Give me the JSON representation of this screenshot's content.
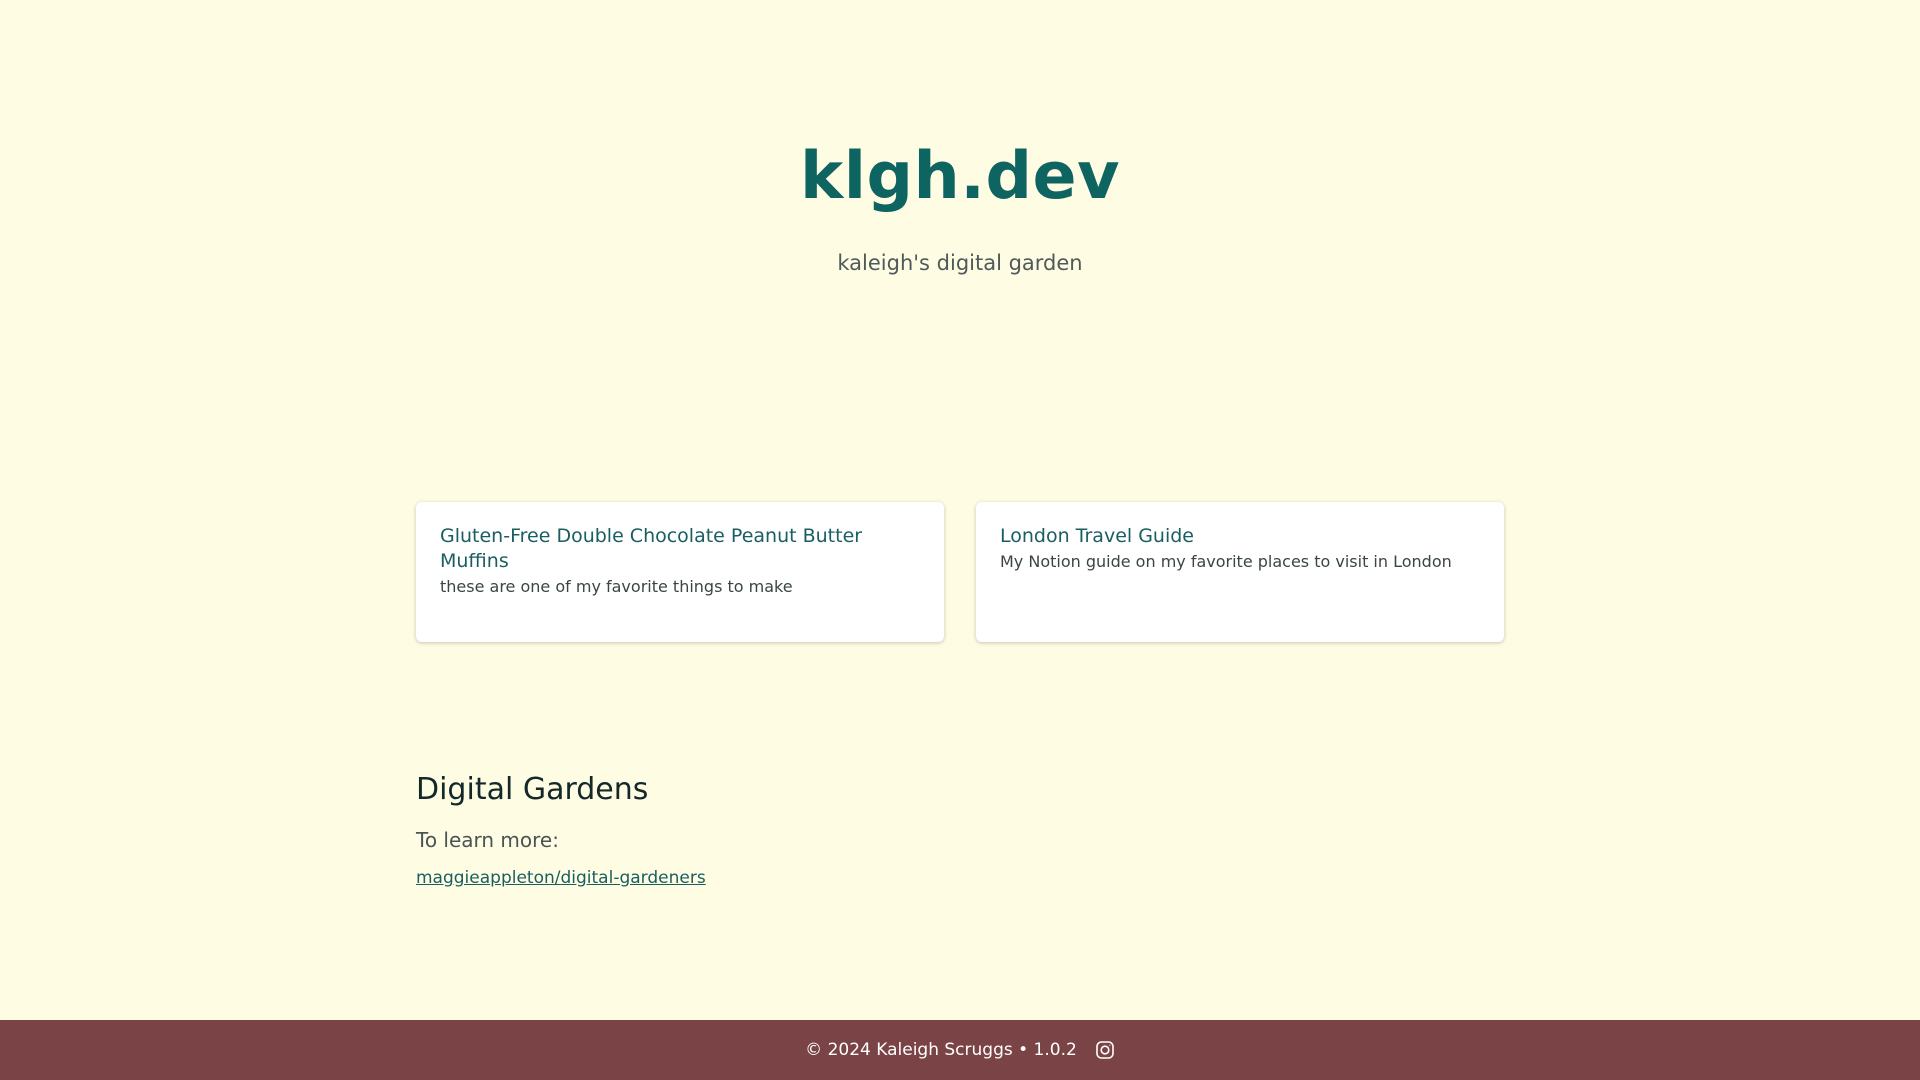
{
  "header": {
    "title": "klgh.dev",
    "tagline": "kaleigh's digital garden"
  },
  "cards": [
    {
      "title": "Gluten-Free Double Chocolate Peanut Butter Muffins",
      "description": "these are one of my favorite things to make"
    },
    {
      "title": "London Travel Guide",
      "description": "My Notion guide on my favorite places to visit in London"
    }
  ],
  "section": {
    "heading": "Digital Gardens",
    "learn_more": "To learn more:",
    "link_text": "maggieappleton/digital-gardeners"
  },
  "footer": {
    "text": "© 2024 Kaleigh Scruggs • 1.0.2",
    "icon": "instagram-icon"
  },
  "colors": {
    "background": "#fefce3",
    "title": "#0e6461",
    "footer": "#7a4345"
  }
}
